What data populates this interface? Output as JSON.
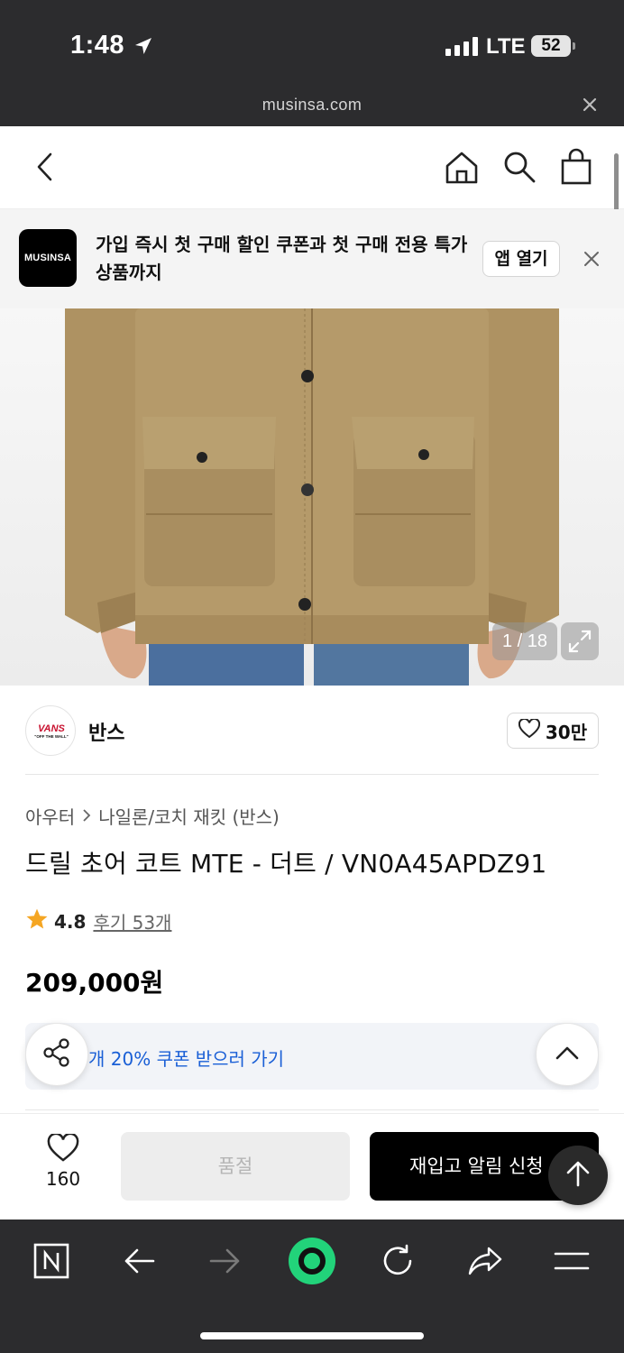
{
  "status_bar": {
    "time": "1:48",
    "network": "LTE",
    "battery": "52"
  },
  "browser": {
    "url": "musinsa.com"
  },
  "app_banner": {
    "logo_text": "MUSINSA",
    "message": "가입 즉시 첫 구매 할인 쿠폰과 첫 구매 전용 특가 상품까지",
    "open_app_label": "앱 열기"
  },
  "gallery": {
    "pager": "1 / 18"
  },
  "brand": {
    "logo_text": "VANS",
    "logo_sub": "\"OFF THE WALL\"",
    "name": "반스",
    "likes": "30만"
  },
  "product": {
    "breadcrumb": [
      "아우터",
      "나일론/코치 재킷 (반스)"
    ],
    "title": "드릴 초어 코트 MTE - 더트 / VN0A45APDZ91",
    "rating": "4.8",
    "reviews": "후기 53개",
    "price": "209,000원"
  },
  "coupon": {
    "text": "개 20% 쿠폰 받으러 가기"
  },
  "purchase_bar": {
    "wish_count": "160",
    "sold_out_label": "품절",
    "restock_label": "재입고 알림 신청"
  },
  "colors": {
    "accent_blue": "#1a5fd6",
    "jacket": "#b59a6a",
    "toolbar_green": "#22d37a",
    "star": "#f5a623"
  },
  "icons": [
    "location-arrow-icon",
    "close-icon",
    "back-chevron-icon",
    "home-icon",
    "search-icon",
    "bag-icon",
    "expand-icon",
    "heart-icon",
    "chevron-right-icon",
    "star-icon",
    "share-icon",
    "chevron-up-icon",
    "arrow-up-icon",
    "tabs-n-icon",
    "back-arrow-icon",
    "forward-arrow-icon",
    "green-circle-icon",
    "reload-icon",
    "share-arrow-icon",
    "menu-icon"
  ]
}
